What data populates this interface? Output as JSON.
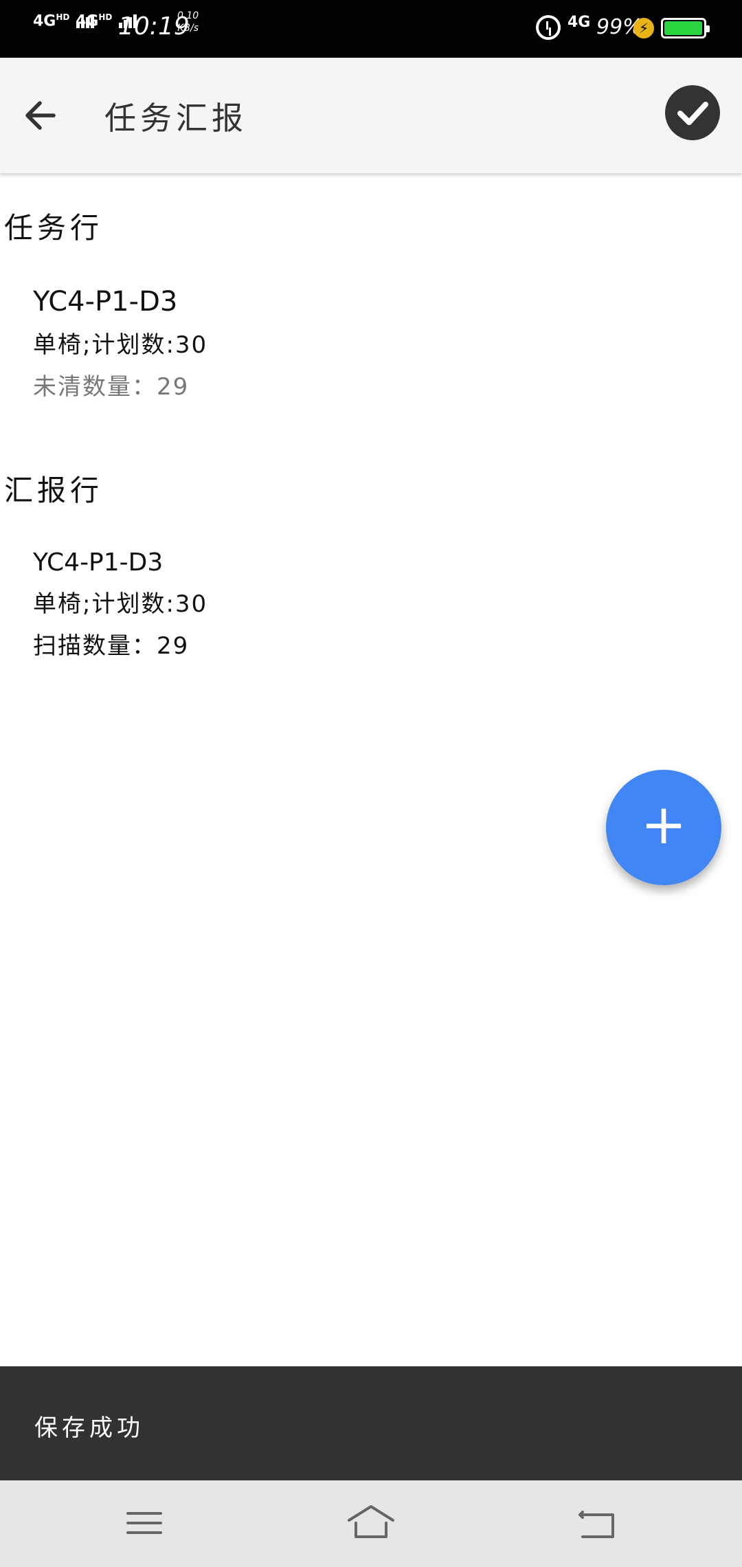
{
  "status_bar": {
    "sim1": "4G",
    "sim1_sup": "HD",
    "sim2": "4G",
    "sim2_sup": "HD",
    "time": "10:19",
    "speed_value": "0.10",
    "speed_unit": "KB/s",
    "network": "4G",
    "battery_percent": "99%",
    "battery_level": 0.99,
    "icons": [
      "alarm-icon",
      "charging-icon",
      "battery-icon"
    ]
  },
  "app_bar": {
    "title": "任务汇报",
    "back_icon": "arrow-left-icon",
    "done_icon": "check-circle-icon"
  },
  "task_section": {
    "title": "任务行",
    "item": {
      "code": "YC4-P1-D3",
      "plan": "单椅;计划数:30",
      "remaining_label": "未清数量：",
      "remaining_value": "29"
    }
  },
  "report_section": {
    "title": "汇报行",
    "item": {
      "code": "YC4-P1-D3",
      "plan": "单椅;计划数:30",
      "scanned_label": "扫描数量：",
      "scanned_value": "29"
    }
  },
  "fab": {
    "label": "+",
    "icon": "plus-icon"
  },
  "snackbar": {
    "message": "保存成功"
  },
  "nav_bar": {
    "icons": [
      "menu-icon",
      "home-icon",
      "back-icon"
    ]
  },
  "colors": {
    "accent": "#4285f4",
    "appbar_bg": "#f5f5f5",
    "snackbar_bg": "#323232",
    "muted_text": "#777777"
  }
}
